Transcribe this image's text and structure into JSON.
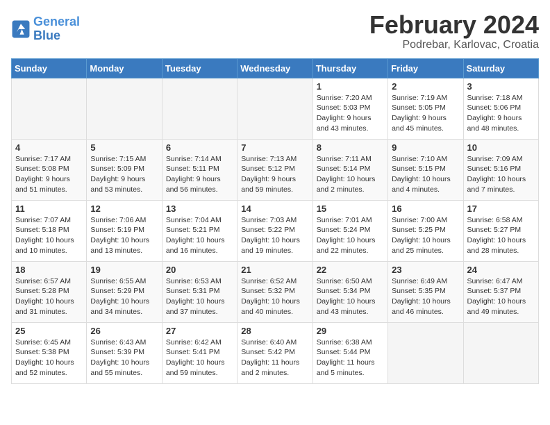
{
  "logo": {
    "line1": "General",
    "line2": "Blue"
  },
  "title": "February 2024",
  "subtitle": "Podrebar, Karlovac, Croatia",
  "headers": [
    "Sunday",
    "Monday",
    "Tuesday",
    "Wednesday",
    "Thursday",
    "Friday",
    "Saturday"
  ],
  "weeks": [
    [
      {
        "day": "",
        "info": ""
      },
      {
        "day": "",
        "info": ""
      },
      {
        "day": "",
        "info": ""
      },
      {
        "day": "",
        "info": ""
      },
      {
        "day": "1",
        "info": "Sunrise: 7:20 AM\nSunset: 5:03 PM\nDaylight: 9 hours\nand 43 minutes."
      },
      {
        "day": "2",
        "info": "Sunrise: 7:19 AM\nSunset: 5:05 PM\nDaylight: 9 hours\nand 45 minutes."
      },
      {
        "day": "3",
        "info": "Sunrise: 7:18 AM\nSunset: 5:06 PM\nDaylight: 9 hours\nand 48 minutes."
      }
    ],
    [
      {
        "day": "4",
        "info": "Sunrise: 7:17 AM\nSunset: 5:08 PM\nDaylight: 9 hours\nand 51 minutes."
      },
      {
        "day": "5",
        "info": "Sunrise: 7:15 AM\nSunset: 5:09 PM\nDaylight: 9 hours\nand 53 minutes."
      },
      {
        "day": "6",
        "info": "Sunrise: 7:14 AM\nSunset: 5:11 PM\nDaylight: 9 hours\nand 56 minutes."
      },
      {
        "day": "7",
        "info": "Sunrise: 7:13 AM\nSunset: 5:12 PM\nDaylight: 9 hours\nand 59 minutes."
      },
      {
        "day": "8",
        "info": "Sunrise: 7:11 AM\nSunset: 5:14 PM\nDaylight: 10 hours\nand 2 minutes."
      },
      {
        "day": "9",
        "info": "Sunrise: 7:10 AM\nSunset: 5:15 PM\nDaylight: 10 hours\nand 4 minutes."
      },
      {
        "day": "10",
        "info": "Sunrise: 7:09 AM\nSunset: 5:16 PM\nDaylight: 10 hours\nand 7 minutes."
      }
    ],
    [
      {
        "day": "11",
        "info": "Sunrise: 7:07 AM\nSunset: 5:18 PM\nDaylight: 10 hours\nand 10 minutes."
      },
      {
        "day": "12",
        "info": "Sunrise: 7:06 AM\nSunset: 5:19 PM\nDaylight: 10 hours\nand 13 minutes."
      },
      {
        "day": "13",
        "info": "Sunrise: 7:04 AM\nSunset: 5:21 PM\nDaylight: 10 hours\nand 16 minutes."
      },
      {
        "day": "14",
        "info": "Sunrise: 7:03 AM\nSunset: 5:22 PM\nDaylight: 10 hours\nand 19 minutes."
      },
      {
        "day": "15",
        "info": "Sunrise: 7:01 AM\nSunset: 5:24 PM\nDaylight: 10 hours\nand 22 minutes."
      },
      {
        "day": "16",
        "info": "Sunrise: 7:00 AM\nSunset: 5:25 PM\nDaylight: 10 hours\nand 25 minutes."
      },
      {
        "day": "17",
        "info": "Sunrise: 6:58 AM\nSunset: 5:27 PM\nDaylight: 10 hours\nand 28 minutes."
      }
    ],
    [
      {
        "day": "18",
        "info": "Sunrise: 6:57 AM\nSunset: 5:28 PM\nDaylight: 10 hours\nand 31 minutes."
      },
      {
        "day": "19",
        "info": "Sunrise: 6:55 AM\nSunset: 5:29 PM\nDaylight: 10 hours\nand 34 minutes."
      },
      {
        "day": "20",
        "info": "Sunrise: 6:53 AM\nSunset: 5:31 PM\nDaylight: 10 hours\nand 37 minutes."
      },
      {
        "day": "21",
        "info": "Sunrise: 6:52 AM\nSunset: 5:32 PM\nDaylight: 10 hours\nand 40 minutes."
      },
      {
        "day": "22",
        "info": "Sunrise: 6:50 AM\nSunset: 5:34 PM\nDaylight: 10 hours\nand 43 minutes."
      },
      {
        "day": "23",
        "info": "Sunrise: 6:49 AM\nSunset: 5:35 PM\nDaylight: 10 hours\nand 46 minutes."
      },
      {
        "day": "24",
        "info": "Sunrise: 6:47 AM\nSunset: 5:37 PM\nDaylight: 10 hours\nand 49 minutes."
      }
    ],
    [
      {
        "day": "25",
        "info": "Sunrise: 6:45 AM\nSunset: 5:38 PM\nDaylight: 10 hours\nand 52 minutes."
      },
      {
        "day": "26",
        "info": "Sunrise: 6:43 AM\nSunset: 5:39 PM\nDaylight: 10 hours\nand 55 minutes."
      },
      {
        "day": "27",
        "info": "Sunrise: 6:42 AM\nSunset: 5:41 PM\nDaylight: 10 hours\nand 59 minutes."
      },
      {
        "day": "28",
        "info": "Sunrise: 6:40 AM\nSunset: 5:42 PM\nDaylight: 11 hours\nand 2 minutes."
      },
      {
        "day": "29",
        "info": "Sunrise: 6:38 AM\nSunset: 5:44 PM\nDaylight: 11 hours\nand 5 minutes."
      },
      {
        "day": "",
        "info": ""
      },
      {
        "day": "",
        "info": ""
      }
    ]
  ]
}
